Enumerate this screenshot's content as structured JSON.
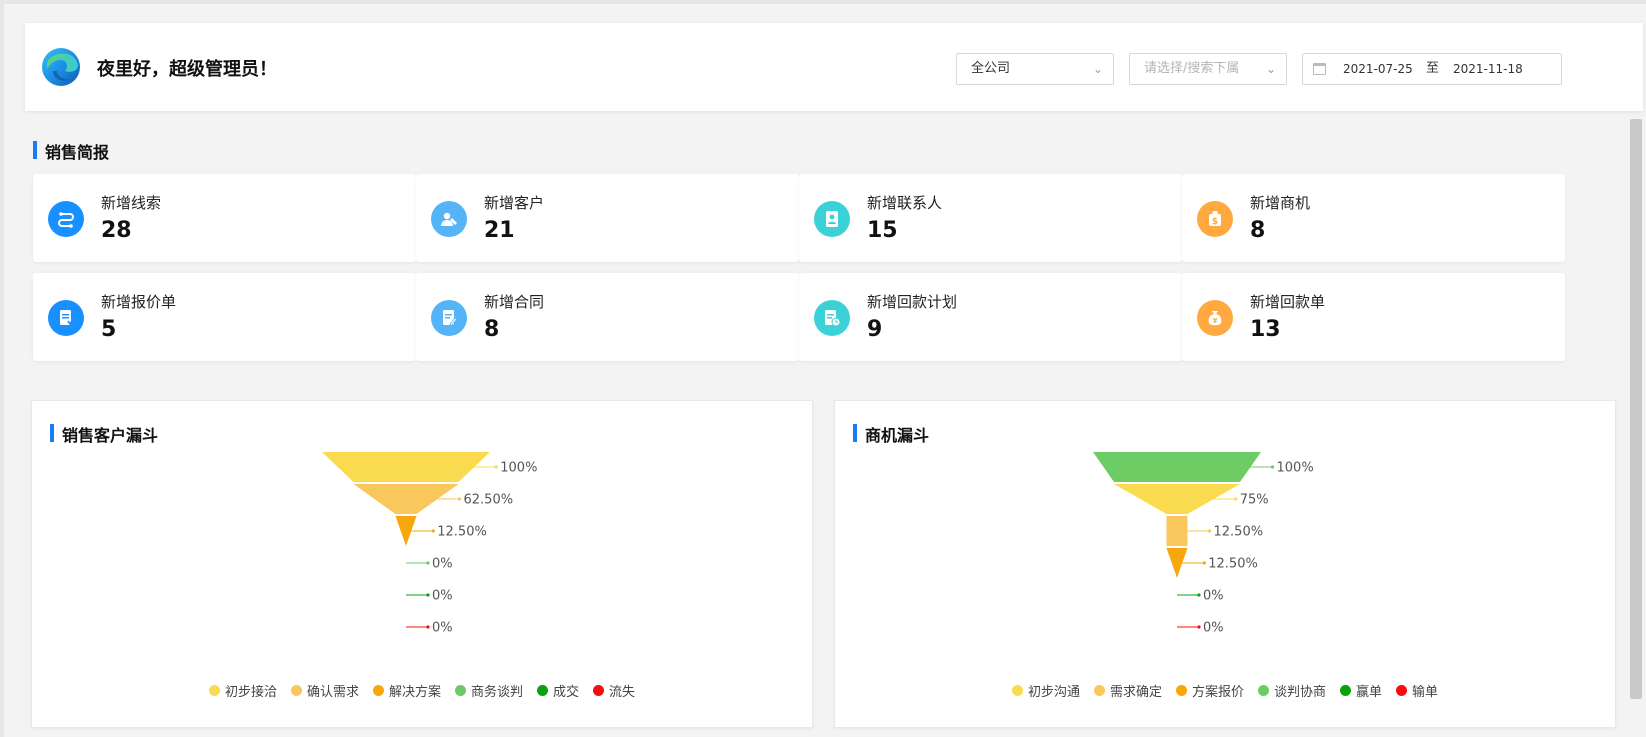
{
  "header": {
    "greeting": "夜里好，超级管理员！",
    "company_select": "全公司",
    "subordinate_placeholder": "请选择/搜索下属",
    "date_start": "2021-07-25",
    "date_sep": "至",
    "date_end": "2021-11-18"
  },
  "sales_brief": {
    "title": "销售简报",
    "cards": [
      {
        "label": "新增线索",
        "value": "28",
        "icon": "lead-icon",
        "color": "#1890ff"
      },
      {
        "label": "新增客户",
        "value": "21",
        "icon": "customer-icon",
        "color": "#55b4f7"
      },
      {
        "label": "新增联系人",
        "value": "15",
        "icon": "contact-icon",
        "color": "#3bd1d6"
      },
      {
        "label": "新增商机",
        "value": "8",
        "icon": "opportunity-icon",
        "color": "#ffa940"
      },
      {
        "label": "新增报价单",
        "value": "5",
        "icon": "quote-icon",
        "color": "#1890ff"
      },
      {
        "label": "新增合同",
        "value": "8",
        "icon": "contract-icon",
        "color": "#55b4f7"
      },
      {
        "label": "新增回款计划",
        "value": "9",
        "icon": "payment-plan-icon",
        "color": "#3bd1d6"
      },
      {
        "label": "新增回款单",
        "value": "13",
        "icon": "payment-receipt-icon",
        "color": "#ffa940"
      }
    ]
  },
  "chart_data": [
    {
      "type": "funnel",
      "title": "销售客户漏斗",
      "categories": [
        "初步接洽",
        "确认需求",
        "解决方案",
        "商务谈判",
        "成交",
        "流失"
      ],
      "values": [
        100,
        62.5,
        12.5,
        0,
        0,
        0
      ],
      "labels": [
        "100%",
        "62.50%",
        "12.50%",
        "0%",
        "0%",
        "0%"
      ],
      "colors": [
        "#fadb4f",
        "#f9c75b",
        "#f7a70a",
        "#6cc964",
        "#0aa10a",
        "#f50e0e"
      ]
    },
    {
      "type": "funnel",
      "title": "商机漏斗",
      "categories": [
        "初步沟通",
        "需求确定",
        "方案报价",
        "谈判协商",
        "赢单",
        "输单"
      ],
      "values": [
        100,
        75,
        12.5,
        12.5,
        0,
        0
      ],
      "labels": [
        "100%",
        "75%",
        "12.50%",
        "12.50%",
        "0%",
        "0%"
      ],
      "colors": [
        "#6dcc63",
        "#fadb4f",
        "#f9c75b",
        "#f7a70a",
        "#0aa10a",
        "#f50e0e"
      ],
      "stage_colors": [
        "#6dcc63",
        "#fadb4f",
        "#f9c75b",
        "#f7a70a",
        "#0aa10a",
        "#f50e0e"
      ],
      "legend_colors": [
        "#fadb4f",
        "#f9c75b",
        "#f7a70a",
        "#6dcc63",
        "#0aa10a",
        "#f50e0e"
      ]
    }
  ]
}
